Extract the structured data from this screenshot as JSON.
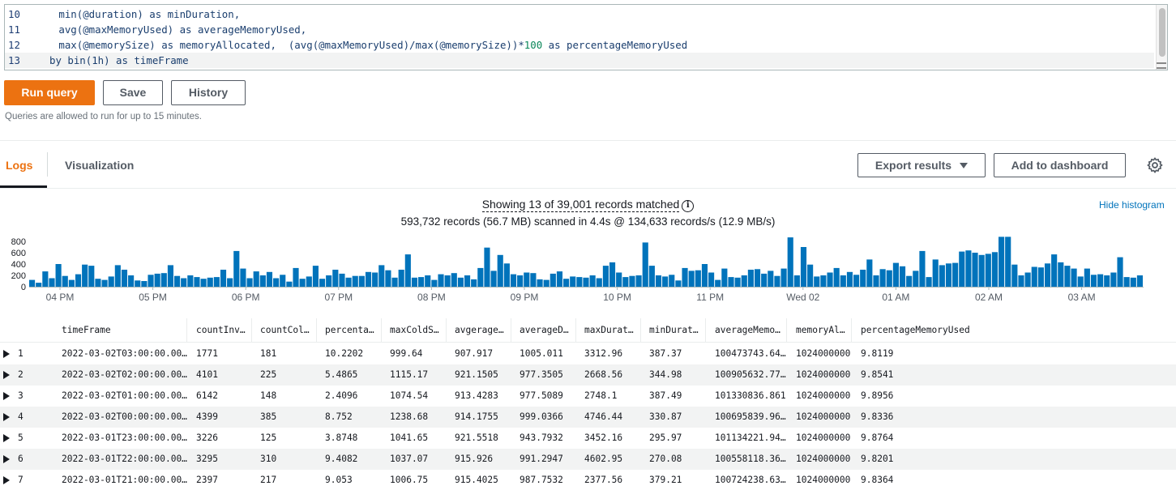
{
  "editor": {
    "lines": [
      {
        "num": "10",
        "pre": "   min(@duration) as minDuration,",
        "numlit": "",
        "post": "",
        "active": false
      },
      {
        "num": "11",
        "pre": "   avg(@maxMemoryUsed) as averageMemoryUsed,",
        "numlit": "",
        "post": "",
        "active": false
      },
      {
        "num": "12",
        "pre": "   max(@memorySize) as memoryAllocated,  (avg(@maxMemoryUsed)/max(@memorySize))*",
        "numlit": "100",
        "post": " as percentageMemoryUsed",
        "active": false
      },
      {
        "num": "13",
        "pre": "by bin(1h) as timeFrame",
        "numlit": "",
        "post": "",
        "active": true
      }
    ]
  },
  "actions": {
    "run": "Run query",
    "save": "Save",
    "history": "History",
    "hint": "Queries are allowed to run for up to 15 minutes."
  },
  "tabs": {
    "logs": "Logs",
    "visualization": "Visualization"
  },
  "toolbar": {
    "export": "Export results",
    "add_dashboard": "Add to dashboard"
  },
  "summary": {
    "showing": "Showing 13 of 39,001 records matched",
    "scanned": "593,732 records (56.7 MB) scanned in 4.4s @ 134,633 records/s (12.9 MB/s)",
    "hide_histogram": "Hide histogram"
  },
  "chart_data": {
    "type": "bar",
    "color": "#0073bb",
    "ylim": [
      0,
      800
    ],
    "yticks": [
      "800",
      "600",
      "400",
      "200",
      "0"
    ],
    "xticks": [
      "04 PM",
      "05 PM",
      "06 PM",
      "07 PM",
      "08 PM",
      "09 PM",
      "10 PM",
      "11 PM",
      "Wed 02",
      "01 AM",
      "02 AM",
      "03 AM"
    ],
    "values": [
      120,
      70,
      270,
      150,
      400,
      190,
      120,
      220,
      390,
      370,
      140,
      120,
      180,
      380,
      300,
      200,
      110,
      100,
      210,
      230,
      240,
      380,
      190,
      150,
      200,
      170,
      140,
      160,
      170,
      300,
      150,
      630,
      320,
      150,
      270,
      200,
      260,
      150,
      210,
      90,
      330,
      140,
      180,
      370,
      140,
      200,
      300,
      230,
      160,
      190,
      190,
      260,
      250,
      380,
      290,
      160,
      300,
      570,
      160,
      170,
      200,
      120,
      220,
      200,
      240,
      160,
      200,
      130,
      330,
      690,
      280,
      560,
      410,
      220,
      200,
      250,
      240,
      130,
      120,
      230,
      270,
      140,
      180,
      170,
      160,
      200,
      150,
      370,
      430,
      250,
      170,
      190,
      200,
      780,
      370,
      200,
      180,
      210,
      110,
      330,
      280,
      290,
      400,
      250,
      120,
      320,
      170,
      160,
      200,
      300,
      310,
      230,
      280,
      190,
      320,
      870,
      200,
      700,
      390,
      180,
      200,
      250,
      330,
      200,
      260,
      210,
      300,
      480,
      200,
      310,
      290,
      420,
      360,
      190,
      280,
      630,
      170,
      480,
      380,
      410,
      420,
      620,
      640,
      600,
      560,
      580,
      610,
      880,
      880,
      390,
      200,
      250,
      350,
      340,
      410,
      570,
      430,
      370,
      320,
      180,
      320,
      210,
      220,
      200,
      250,
      520,
      170,
      160,
      200
    ],
    "n": 169
  },
  "table": {
    "columns": [
      "timeFrame",
      "countInv…",
      "countCol…",
      "percenta…",
      "maxColdS…",
      "avgerage…",
      "averageD…",
      "maxDurat…",
      "minDurat…",
      "averageMemo…",
      "memoryAl…",
      "percentageMemoryUsed"
    ],
    "rows": [
      {
        "idx": "1",
        "cells": [
          "2022-03-02T03:00:00.00…",
          "1771",
          "181",
          "10.2202",
          "999.64",
          "907.917",
          "1005.011",
          "3312.96",
          "387.37",
          "100473743.64…",
          "1024000000",
          "9.8119"
        ]
      },
      {
        "idx": "2",
        "cells": [
          "2022-03-02T02:00:00.00…",
          "4101",
          "225",
          "5.4865",
          "1115.17",
          "921.1505",
          "977.3505",
          "2668.56",
          "344.98",
          "100905632.77…",
          "1024000000",
          "9.8541"
        ]
      },
      {
        "idx": "3",
        "cells": [
          "2022-03-02T01:00:00.00…",
          "6142",
          "148",
          "2.4096",
          "1074.54",
          "913.4283",
          "977.5089",
          "2748.1",
          "387.49",
          "101330836.861",
          "1024000000",
          "9.8956"
        ]
      },
      {
        "idx": "4",
        "cells": [
          "2022-03-02T00:00:00.00…",
          "4399",
          "385",
          "8.752",
          "1238.68",
          "914.1755",
          "999.0366",
          "4746.44",
          "330.87",
          "100695839.96…",
          "1024000000",
          "9.8336"
        ]
      },
      {
        "idx": "5",
        "cells": [
          "2022-03-01T23:00:00.00…",
          "3226",
          "125",
          "3.8748",
          "1041.65",
          "921.5518",
          "943.7932",
          "3452.16",
          "295.97",
          "101134221.94…",
          "1024000000",
          "9.8764"
        ]
      },
      {
        "idx": "6",
        "cells": [
          "2022-03-01T22:00:00.00…",
          "3295",
          "310",
          "9.4082",
          "1037.07",
          "915.926",
          "991.2947",
          "4602.95",
          "270.08",
          "100558118.36…",
          "1024000000",
          "9.8201"
        ]
      },
      {
        "idx": "7",
        "cells": [
          "2022-03-01T21:00:00.00…",
          "2397",
          "217",
          "9.053",
          "1006.75",
          "915.4025",
          "987.7532",
          "2377.56",
          "379.21",
          "100724238.63…",
          "1024000000",
          "9.8364"
        ]
      }
    ]
  }
}
